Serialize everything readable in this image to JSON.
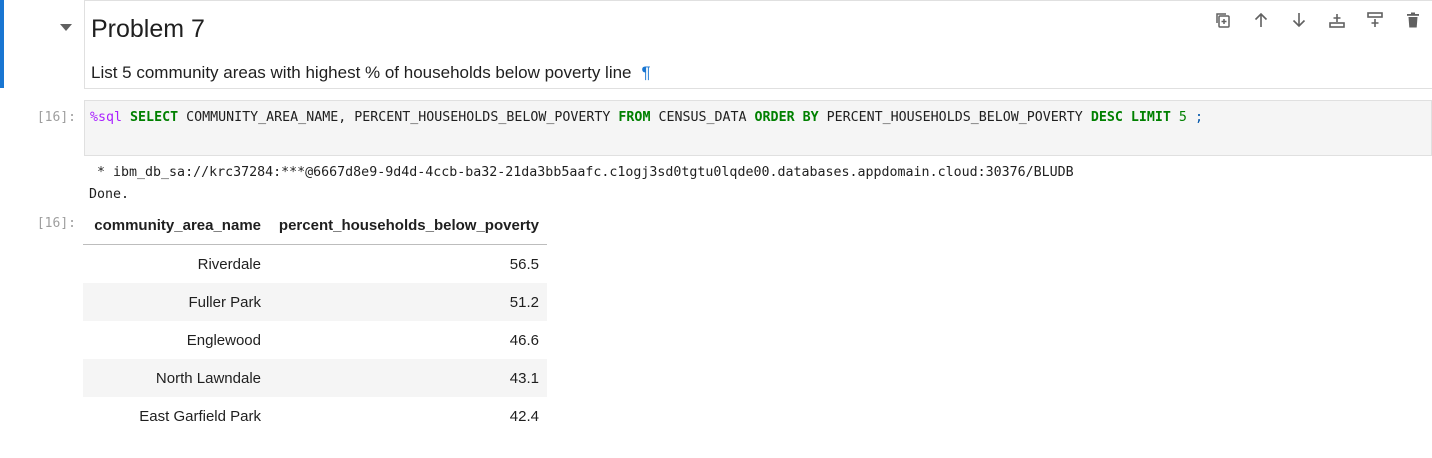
{
  "markdown_cell": {
    "title": "Problem 7",
    "text": "List 5 community areas with highest % of households below poverty line",
    "anchor": "¶"
  },
  "toolbar": [
    {
      "name": "duplicate-cell-icon",
      "label": "Duplicate"
    },
    {
      "name": "move-up-icon",
      "label": "Move up"
    },
    {
      "name": "move-down-icon",
      "label": "Move down"
    },
    {
      "name": "insert-below-icon",
      "label": "Insert below"
    },
    {
      "name": "insert-above-icon",
      "label": "Insert above"
    },
    {
      "name": "delete-cell-icon",
      "label": "Delete"
    }
  ],
  "code_cell": {
    "input_prompt": "[16]:",
    "output_prompt": "[16]:",
    "tokens": {
      "magic": "%sql",
      "select": "SELECT",
      "columns": "COMMUNITY_AREA_NAME, PERCENT_HOUSEHOLDS_BELOW_POVERTY",
      "from": "FROM",
      "table": "CENSUS_DATA",
      "order_by": "ORDER BY",
      "order_col": "PERCENT_HOUSEHOLDS_BELOW_POVERTY",
      "desc": "DESC",
      "limit": "LIMIT",
      "limit_val": "5",
      "semicolon": ";"
    },
    "connection": " * ibm_db_sa://krc37284:***@6667d8e9-9d4d-4ccb-ba32-21da3bb5aafc.c1ogj3sd0tgtu0lqde00.databases.appdomain.cloud:30376/BLUDB",
    "status": "Done."
  },
  "result_table": {
    "headers": [
      "community_area_name",
      "percent_households_below_poverty"
    ],
    "rows": [
      [
        "Riverdale",
        "56.5"
      ],
      [
        "Fuller Park",
        "51.2"
      ],
      [
        "Englewood",
        "46.6"
      ],
      [
        "North Lawndale",
        "43.1"
      ],
      [
        "East Garfield Park",
        "42.4"
      ]
    ]
  }
}
